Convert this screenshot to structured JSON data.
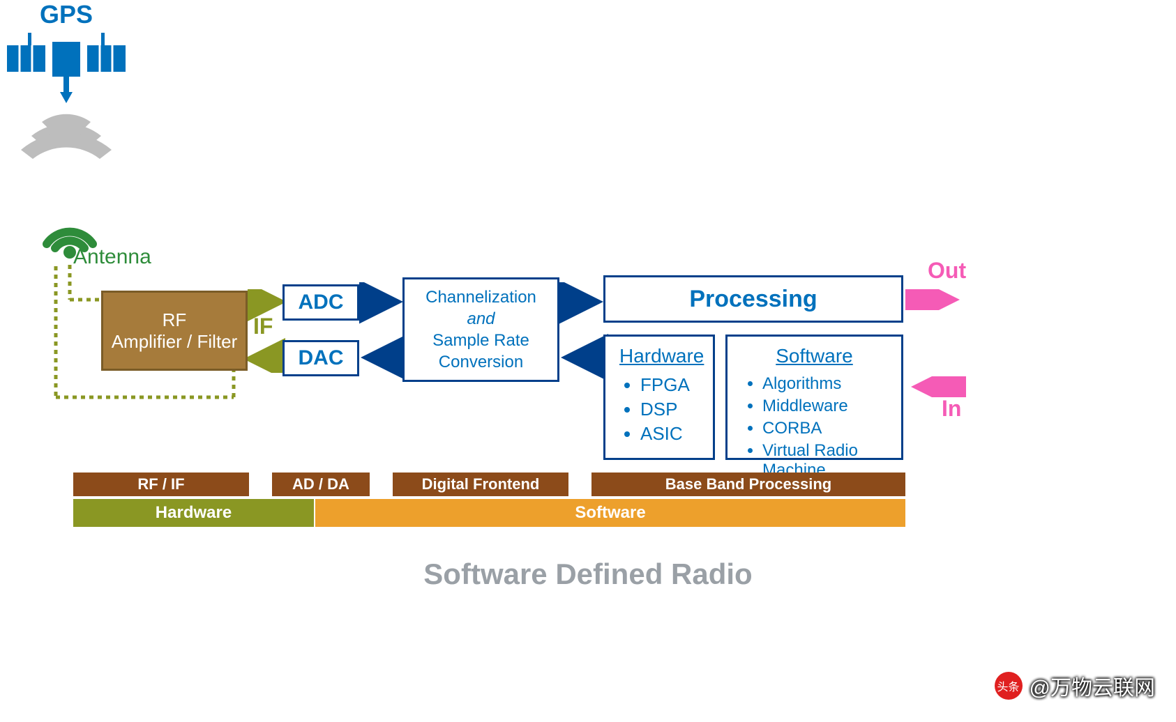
{
  "title": "Software Defined Radio",
  "watermark": {
    "prefix": "头条",
    "handle": "@万物云联网"
  },
  "labels": {
    "gps": "GPS",
    "antenna": "Antenna",
    "if": "IF",
    "out": "Out",
    "in": "In"
  },
  "blocks": {
    "rf": {
      "line1": "RF",
      "line2": "Amplifier / Filter"
    },
    "adc": "ADC",
    "dac": "DAC",
    "chan": {
      "line1": "Channelization",
      "line2": "and",
      "line3": "Sample Rate",
      "line4": "Conversion"
    },
    "processing": "Processing"
  },
  "hardware_list": {
    "title": "Hardware",
    "items": [
      "FPGA",
      "DSP",
      "ASIC"
    ]
  },
  "software_list": {
    "title": "Software",
    "items": [
      "Algorithms",
      "Middleware",
      "CORBA",
      "Virtual Radio Machine"
    ]
  },
  "stage_bars": {
    "rf_if": "RF / IF",
    "ad_da": "AD / DA",
    "digital_frontend": "Digital Frontend",
    "baseband": "Base Band Processing",
    "hardware": "Hardware",
    "software": "Software"
  },
  "colors": {
    "blue": "#0071bc",
    "darkblue": "#003f8a",
    "olive": "#8a9723",
    "tan": "#a67b3b",
    "brown": "#8c4b1a",
    "orange": "#eda02c",
    "green": "#2e8c3a",
    "magenta": "#f55bb6",
    "gray": "#9e9e9e"
  }
}
